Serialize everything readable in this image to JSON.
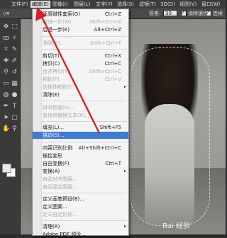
{
  "menubar": {
    "items": [
      {
        "label": "文件(F)"
      },
      {
        "label": "编辑(E)"
      },
      {
        "label": "图像(I)"
      },
      {
        "label": "图层(L)"
      },
      {
        "label": "文字(Y)"
      },
      {
        "label": "选择(S)"
      },
      {
        "label": "滤镜(T)"
      },
      {
        "label": "3D(D)"
      },
      {
        "label": "视图(V)"
      },
      {
        "label": "窗口(W)"
      }
    ]
  },
  "options": {
    "tolerance_label": "容差:",
    "tolerance_value": "30",
    "antialias_label": "消除锯齿",
    "contiguous_label": "连续"
  },
  "menu": {
    "items": [
      {
        "label": "还原磁性套索(O)",
        "shortcut": "Ctrl+Z"
      },
      {
        "label": "前进一步(W)",
        "shortcut": "Shift+Ctrl+Z"
      },
      {
        "label": "后退一步(K)",
        "shortcut": "Alt+Ctrl+Z"
      },
      {
        "label": "渐隐(D)...",
        "shortcut": "Shift+Ctrl+F"
      },
      {
        "label": "剪切(T)",
        "shortcut": "Ctrl+X"
      },
      {
        "label": "拷贝(C)",
        "shortcut": "Ctrl+C"
      },
      {
        "label": "合并拷贝(Y)",
        "shortcut": "Shift+Ctrl+C"
      },
      {
        "label": "粘贴(P)",
        "shortcut": "Ctrl+V"
      },
      {
        "label": "选择性粘贴(I)",
        "shortcut": ""
      },
      {
        "label": "清除(E)",
        "shortcut": ""
      },
      {
        "label": "拼写检查(H)...",
        "shortcut": ""
      },
      {
        "label": "查找和替换文本(X)...",
        "shortcut": ""
      },
      {
        "label": "填充(L)...",
        "shortcut": "Shift+F5"
      },
      {
        "label": "描边(S)...",
        "shortcut": ""
      },
      {
        "label": "内容识别比例",
        "shortcut": "Alt+Shift+Ctrl+C"
      },
      {
        "label": "操控变形",
        "shortcut": ""
      },
      {
        "label": "自由变换(F)",
        "shortcut": "Ctrl+T"
      },
      {
        "label": "变换(A)",
        "shortcut": ""
      },
      {
        "label": "自动对齐图层...",
        "shortcut": ""
      },
      {
        "label": "自动混合图层...",
        "shortcut": ""
      },
      {
        "label": "定义画笔预设(B)...",
        "shortcut": ""
      },
      {
        "label": "定义图案...",
        "shortcut": ""
      },
      {
        "label": "定义自定形状...",
        "shortcut": ""
      },
      {
        "label": "清理(R)",
        "shortcut": ""
      },
      {
        "label": "Adobe PDF 预设...",
        "shortcut": ""
      }
    ]
  },
  "watermark": "Bai 经验",
  "colors": {
    "highlight": "#3f7ad6",
    "arrow": "#d8202a"
  }
}
